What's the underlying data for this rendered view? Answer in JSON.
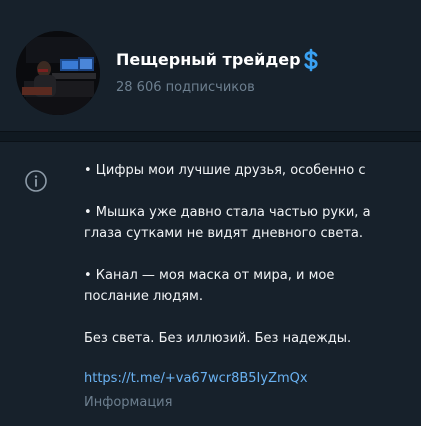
{
  "channel": {
    "title": "Пещерный трейдер",
    "subscribers": "28 606 подписчиков",
    "badge_color": "#3aa1f2"
  },
  "about": {
    "lines": [
      [
        "• Цифры мои лучшие друзья, особенно с"
      ],
      [
        "• Мышка уже давно стала частью руки, а",
        "глаза сутками не видят дневного света."
      ],
      [
        "• Канал — моя маска от мира, и мое",
        "послание людям."
      ],
      [
        "Без света. Без иллюзий. Без надежды."
      ]
    ],
    "link": "https://t.me/+va67wcr8B5IyZmQx",
    "label": "Информация"
  },
  "icons": {
    "badge": "dollar-badge-icon",
    "info": "info-circle-icon"
  },
  "colors": {
    "background": "#17212b",
    "link": "#6ab2f2",
    "muted": "#6d7f8f"
  }
}
